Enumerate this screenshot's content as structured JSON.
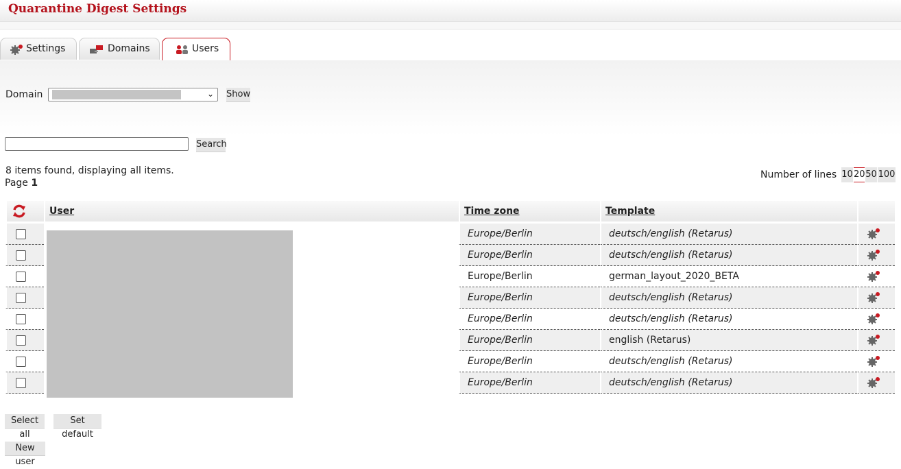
{
  "header": {
    "title": "Quarantine Digest Settings"
  },
  "tabs": [
    {
      "label": "Settings",
      "icon": "gear-icon"
    },
    {
      "label": "Domains",
      "icon": "domains-icon"
    },
    {
      "label": "Users",
      "icon": "users-icon",
      "active": true
    }
  ],
  "filter": {
    "domain_label": "Domain",
    "domain_value": "",
    "show_label": "Show",
    "search_value": "",
    "search_label": "Search"
  },
  "results": {
    "summary": "8 items found, displaying all items.",
    "page_label": "Page",
    "page_number": "1"
  },
  "lines": {
    "label": "Number of lines",
    "options": [
      "10",
      "20",
      "50",
      "100"
    ],
    "selected": "20"
  },
  "table": {
    "columns": [
      "User",
      "Time zone",
      "Template"
    ],
    "header_icon": "reset-icon",
    "row_icon": "gear-settings-icon",
    "rows": [
      {
        "timezone": "Europe/Berlin",
        "template": "deutsch/english (Retarus)",
        "italic": true
      },
      {
        "timezone": "Europe/Berlin",
        "template": "deutsch/english (Retarus)",
        "italic": true
      },
      {
        "timezone": "Europe/Berlin",
        "template": "german_layout_2020_BETA",
        "italic": false
      },
      {
        "timezone": "Europe/Berlin",
        "template": "deutsch/english (Retarus)",
        "italic": true
      },
      {
        "timezone": "Europe/Berlin",
        "template": "deutsch/english (Retarus)",
        "italic": true
      },
      {
        "timezone": "Europe/Berlin",
        "template": "english (Retarus)",
        "italic": false
      },
      {
        "timezone": "Europe/Berlin",
        "template": "deutsch/english (Retarus)",
        "italic": true
      },
      {
        "timezone": "Europe/Berlin",
        "template": "deutsch/english (Retarus)",
        "italic": true
      }
    ]
  },
  "actions": {
    "select_all": "Select all",
    "set_default": "Set default",
    "new_user": "New user"
  },
  "colors": {
    "accent": "#c81a22",
    "title": "#b4121c",
    "button_bg": "#e6e6e6"
  }
}
